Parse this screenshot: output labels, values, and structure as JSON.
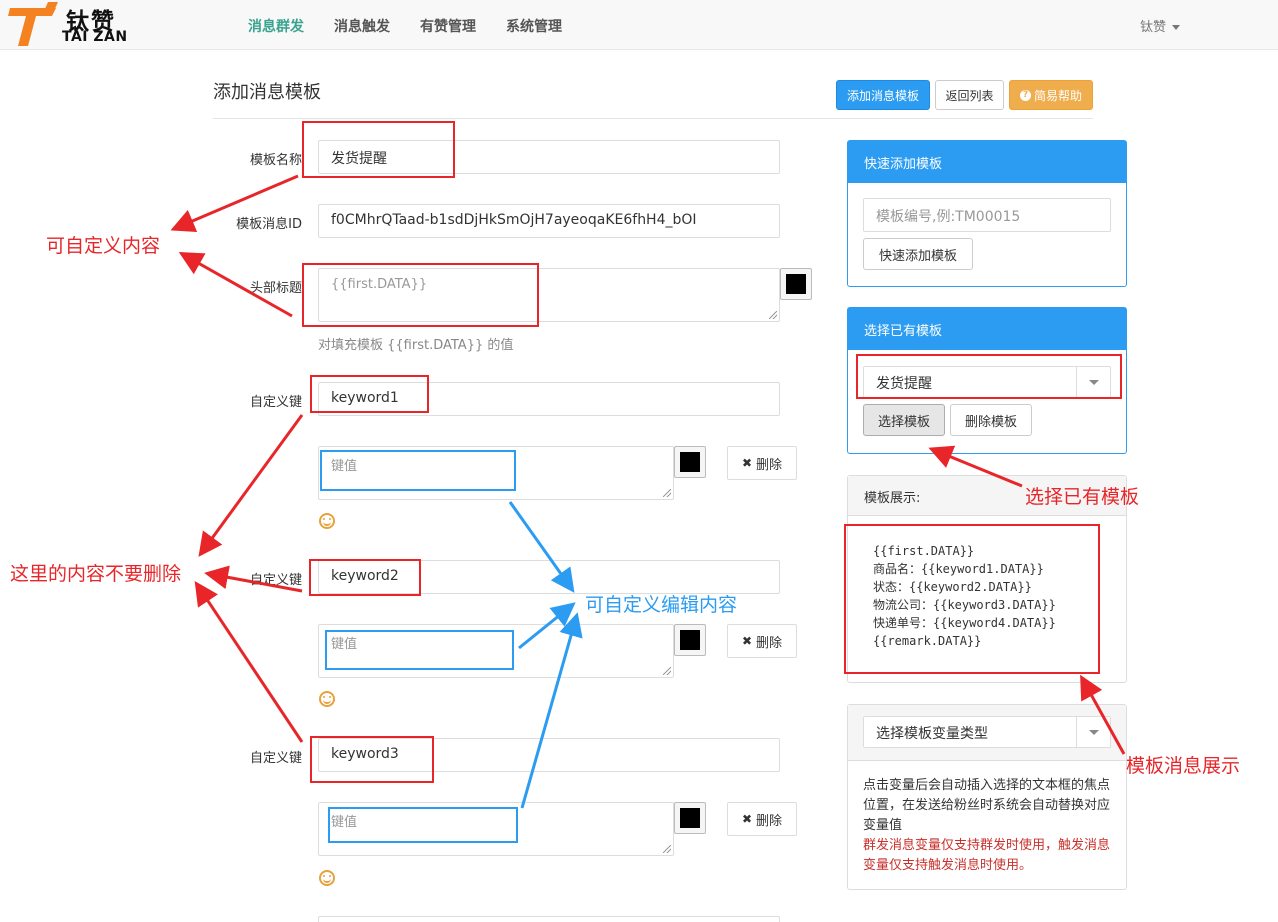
{
  "brand": {
    "cn": "钛赞",
    "en": "TAI ZAN",
    "accent": "#f58220"
  },
  "nav": {
    "items": [
      {
        "label": "消息群发",
        "active": true
      },
      {
        "label": "消息触发",
        "active": false
      },
      {
        "label": "有赞管理",
        "active": false
      },
      {
        "label": "系统管理",
        "active": false
      }
    ],
    "user": "钛赞"
  },
  "page": {
    "title": "添加消息模板",
    "buttons": {
      "add": "添加消息模板",
      "back": "返回列表",
      "help": "简易帮助"
    }
  },
  "form": {
    "name_label": "模板名称",
    "name_value": "发货提醒",
    "id_label": "模板消息ID",
    "id_value": "f0CMhrQTaad-b1sdDjHkSmOjH7ayeoqaKE6fhH4_bOI",
    "header_label": "头部标题",
    "header_placeholder": "{{first.DATA}}",
    "header_hint": "对填充模板 {{first.DATA}} 的值",
    "keys": [
      {
        "label": "自定义键",
        "key": "keyword1",
        "value_placeholder": "键值",
        "delete_label": "删除"
      },
      {
        "label": "自定义键",
        "key": "keyword2",
        "value_placeholder": "键值",
        "delete_label": "删除"
      },
      {
        "label": "自定义键",
        "key": "keyword3",
        "value_placeholder": "键值",
        "delete_label": "删除"
      }
    ]
  },
  "quick_add": {
    "title": "快速添加模板",
    "placeholder": "模板编号,例:TM00015",
    "button": "快速添加模板"
  },
  "select_existing": {
    "title": "选择已有模板",
    "selected": "发货提醒",
    "select_button": "选择模板",
    "delete_button": "删除模板"
  },
  "preview": {
    "title": "模板展示:",
    "lines": [
      "{{first.DATA}}",
      "商品名：{{keyword1.DATA}}",
      "状态：{{keyword2.DATA}}",
      "物流公司：{{keyword3.DATA}}",
      "快递单号：{{keyword4.DATA}}",
      "{{remark.DATA}}"
    ]
  },
  "variables": {
    "selected": "选择模板变量类型",
    "desc": "点击变量后会自动插入选择的文本框的焦点位置，在发送给粉丝时系统会自动替换对应变量值",
    "desc_red": "群发消息变量仅支持群发时使用，触发消息变量仅支持触发消息时使用。"
  },
  "annotations": {
    "customizable": "可自定义内容",
    "do_not_delete": "这里的内容不要删除",
    "editable": "可自定义编辑内容",
    "select_existing": "选择已有模板",
    "preview": "模板消息展示"
  },
  "colors": {
    "primary": "#2b9cf2",
    "warning": "#f0ad4e",
    "nav_active": "#3aa38f",
    "annotation_red": "#e8262a",
    "annotation_blue": "#2b9cf2"
  }
}
